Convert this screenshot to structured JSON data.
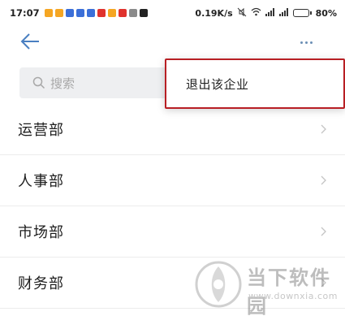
{
  "status_bar": {
    "time": "17:07",
    "net_speed": "0.19K/s",
    "battery_pct": "80%",
    "battery_level": 0.8,
    "notification_colors": [
      "#f5a623",
      "#f5a623",
      "#3b6fd8",
      "#3b6fd8",
      "#3b6fd8",
      "#e0322d",
      "#f5a623",
      "#e0322d",
      "#8a8a8a",
      "#222222"
    ]
  },
  "header": {
    "back_icon": "arrow-left-icon",
    "more_icon": "more-dots-icon"
  },
  "search": {
    "placeholder": "搜索"
  },
  "popup_menu": {
    "items": [
      {
        "label": "退出该企业"
      }
    ]
  },
  "departments": [
    {
      "name": "运营部",
      "count": ""
    },
    {
      "name": "人事部",
      "count": ""
    },
    {
      "name": "市场部",
      "count": ""
    },
    {
      "name": "财务部",
      "count": ""
    }
  ],
  "watermark": {
    "title": "当下软件园",
    "url": "www.downxia.com"
  },
  "colors": {
    "accent": "#4a7fc1",
    "highlight_border": "#b81f24",
    "search_bg": "#eeeff1"
  }
}
